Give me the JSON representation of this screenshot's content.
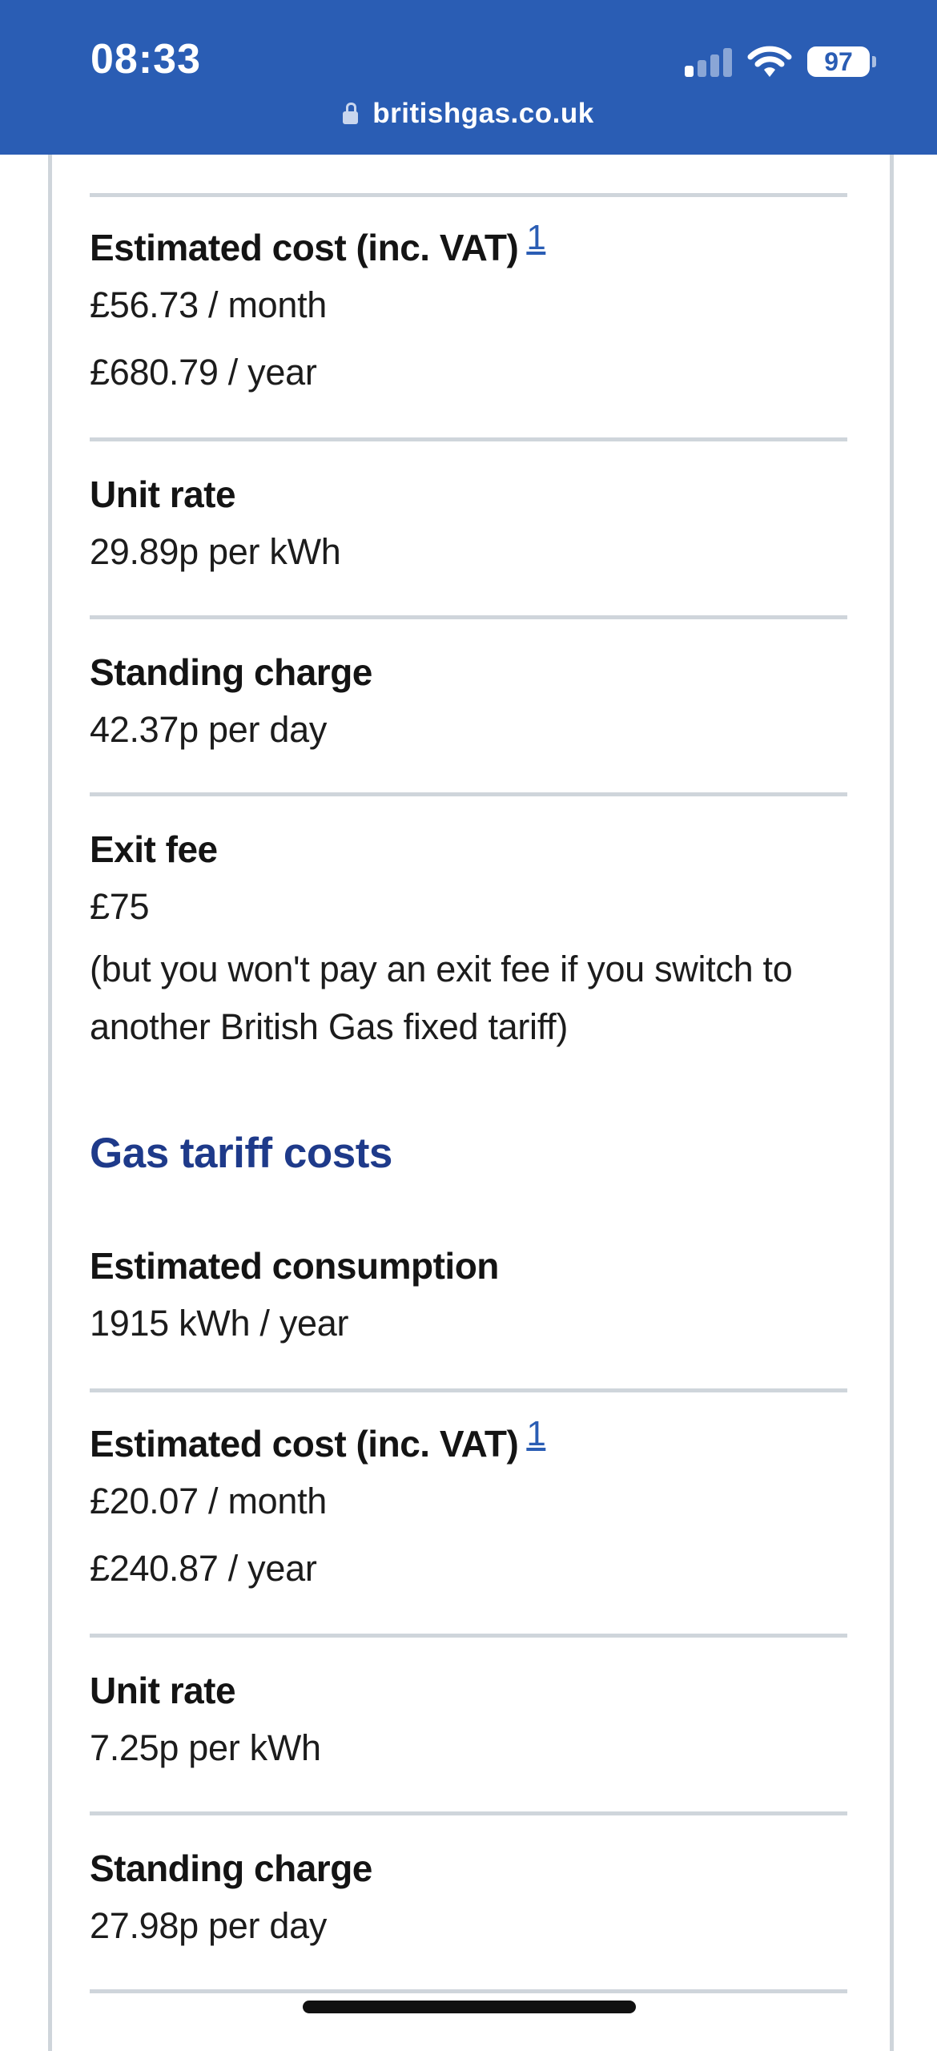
{
  "status_bar": {
    "time": "08:33",
    "battery": "97",
    "url": "britishgas.co.uk"
  },
  "electricity": {
    "estimated_cost": {
      "label": "Estimated cost (inc. VAT)",
      "footnote": "1",
      "monthly": "£56.73 / month",
      "yearly": "£680.79 / year"
    },
    "unit_rate": {
      "label": "Unit rate",
      "value": "29.89p per kWh"
    },
    "standing_charge": {
      "label": "Standing charge",
      "value": "42.37p per day"
    },
    "exit_fee": {
      "label": "Exit fee",
      "value": "£75",
      "note": "(but you won't pay an exit fee if you switch to another British Gas fixed tariff)"
    }
  },
  "gas": {
    "heading": "Gas tariff costs",
    "estimated_consumption": {
      "label": "Estimated consumption",
      "value": "1915 kWh / year"
    },
    "estimated_cost": {
      "label": "Estimated cost (inc. VAT)",
      "footnote": "1",
      "monthly": "£20.07 / month",
      "yearly": "£240.87 / year"
    },
    "unit_rate": {
      "label": "Unit rate",
      "value": "7.25p per kWh"
    },
    "standing_charge": {
      "label": "Standing charge",
      "value": "27.98p per day"
    }
  },
  "colors": {
    "top_bar": "#2a5db4",
    "heading": "#1e3a8a",
    "link": "#2a5db4",
    "divider": "#cfd5db"
  },
  "icons": {
    "lock": "lock-icon",
    "signal": "cellular-signal-icon",
    "wifi": "wifi-icon",
    "battery": "battery-icon"
  }
}
